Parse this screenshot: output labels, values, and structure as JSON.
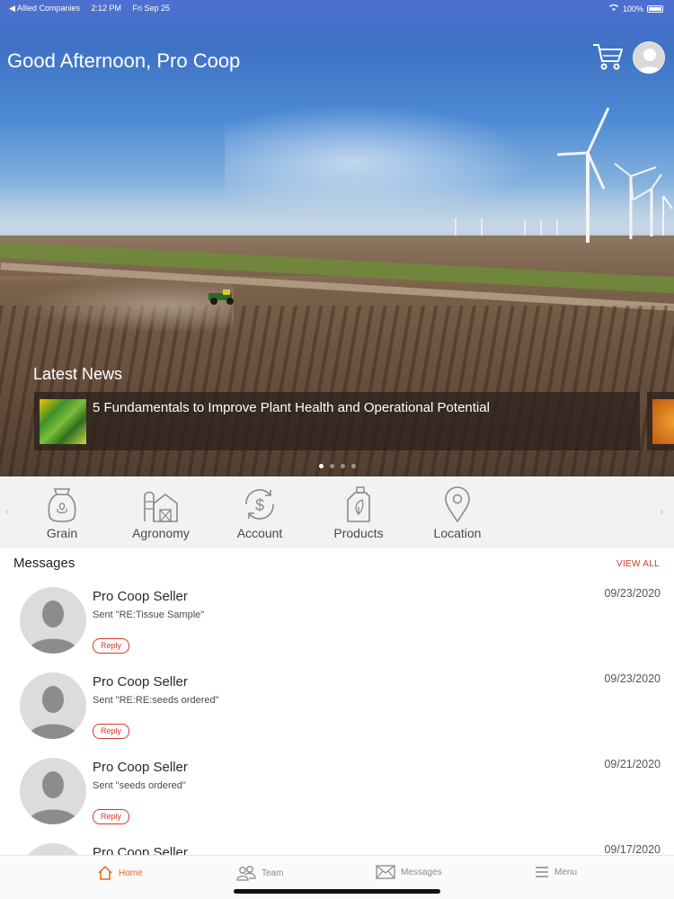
{
  "status_bar": {
    "carrier": "◀ Allied Companies",
    "time": "2:12 PM",
    "date": "Fri Sep 25",
    "battery": "100%"
  },
  "header": {
    "greeting": "Good Afternoon, Pro Coop"
  },
  "news": {
    "title": "Latest News",
    "items": [
      {
        "headline": "5 Fundamentals to Improve Plant Health and Operational Potential"
      }
    ],
    "pages": 4,
    "active_page": 1
  },
  "quick_nav": [
    {
      "label": "Grain",
      "icon": "grain-sack-icon"
    },
    {
      "label": "Agronomy",
      "icon": "barn-icon"
    },
    {
      "label": "Account",
      "icon": "dollar-icon"
    },
    {
      "label": "Products",
      "icon": "jug-icon"
    },
    {
      "label": "Location",
      "icon": "location-pin-icon"
    }
  ],
  "messages": {
    "title": "Messages",
    "view_all": "VIEW ALL",
    "reply_label": "Reply",
    "items": [
      {
        "sender": "Pro Coop Seller",
        "text": "Sent \"RE:Tissue Sample\"",
        "date": "09/23/2020"
      },
      {
        "sender": "Pro Coop Seller",
        "text": "Sent \"RE:RE:seeds ordered\"",
        "date": "09/23/2020"
      },
      {
        "sender": "Pro Coop Seller",
        "text": "Sent \"seeds ordered\"",
        "date": "09/21/2020"
      },
      {
        "sender": "Pro Coop Seller",
        "text": "",
        "date": "09/17/2020"
      }
    ]
  },
  "tab_bar": [
    {
      "label": "Home",
      "active": true
    },
    {
      "label": "Team",
      "active": false
    },
    {
      "label": "Messages",
      "active": false
    },
    {
      "label": "Menu",
      "active": false
    }
  ],
  "colors": {
    "accent": "#d23a2a",
    "active_tab": "#e06a1a",
    "quicknav_bg": "#f2f2f2"
  }
}
